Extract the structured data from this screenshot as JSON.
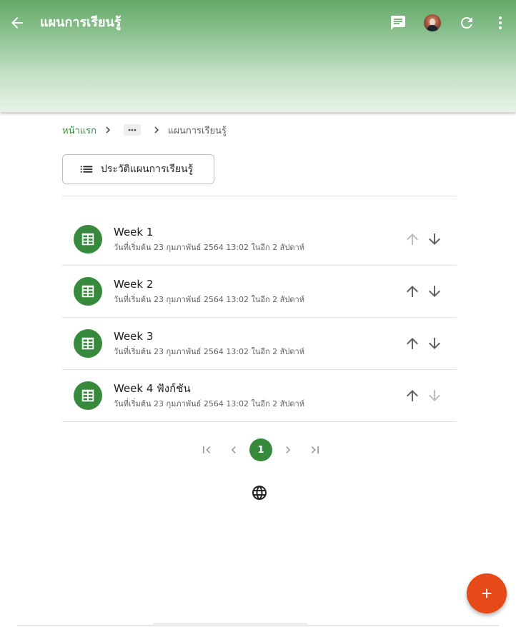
{
  "app_bar": {
    "title": "แผนการเรียนรู้",
    "icons": [
      "back-arrow-icon",
      "chat-icon",
      "user-avatar",
      "refresh-icon",
      "more-vert-icon"
    ],
    "gradient_colors": [
      "#64a968",
      "#e9f3e9"
    ]
  },
  "breadcrumb": {
    "home": "หน้าแรก",
    "current": "แผนการเรียนรู้"
  },
  "history_button": {
    "label": "ประวัติแผนการเรียนรู้",
    "icon": "list-icon"
  },
  "items": [
    {
      "title": "Week 1",
      "subtitle": "วันที่เริ่มต้น 23 กุมภาพันธ์ 2564 13:02 ในอีก 2 สัปดาห์",
      "up_enabled": false,
      "down_enabled": true
    },
    {
      "title": "Week 2",
      "subtitle": "วันที่เริ่มต้น 23 กุมภาพันธ์ 2564 13:02 ในอีก 2 สัปดาห์",
      "up_enabled": true,
      "down_enabled": true
    },
    {
      "title": "Week 3",
      "subtitle": "วันที่เริ่มต้น 23 กุมภาพันธ์ 2564 13:02 ในอีก 2 สัปดาห์",
      "up_enabled": true,
      "down_enabled": true
    },
    {
      "title": "Week 4 ฟังก์ชัน",
      "subtitle": "วันที่เริ่มต้น 23 กุมภาพันธ์ 2564 13:02 ในอีก 2 สัปดาห์",
      "up_enabled": true,
      "down_enabled": false
    }
  ],
  "pagination": {
    "current_page": "1"
  },
  "colors": {
    "accent": "#378a3c",
    "fab": "#e64a19",
    "enabled_icon": "#616161",
    "disabled_icon": "#bdbdbd"
  }
}
